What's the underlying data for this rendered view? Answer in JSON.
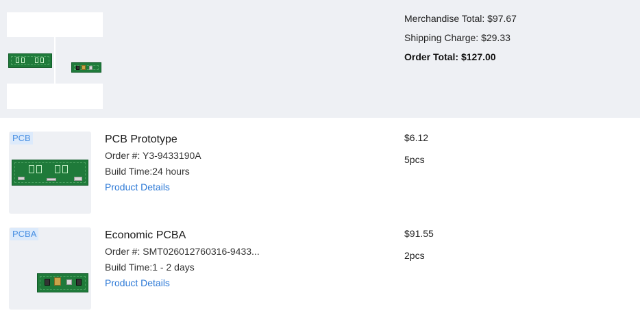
{
  "summary": {
    "merchandise_total": "Merchandise Total: $97.67",
    "shipping_charge": "Shipping Charge: $29.33",
    "order_total": "Order Total: $127.00"
  },
  "products": [
    {
      "tag": "PCB",
      "name": "PCB Prototype",
      "order_no": "Order #: Y3-9433190A",
      "build_time": "Build Time:24 hours",
      "details_link": "Product Details",
      "price": "$6.12",
      "quantity": "5pcs"
    },
    {
      "tag": "PCBA",
      "name": "Economic PCBA",
      "order_no": "Order #: SMT026012760316-9433...",
      "build_time": "Build Time:1 - 2 days",
      "details_link": "Product Details",
      "price": "$91.55",
      "quantity": "2pcs"
    }
  ],
  "colors": {
    "board_green": "#1f7a3a",
    "link_blue": "#2b78d6",
    "tag_bg": "#dceafb",
    "band_bg": "#eef0f4"
  }
}
